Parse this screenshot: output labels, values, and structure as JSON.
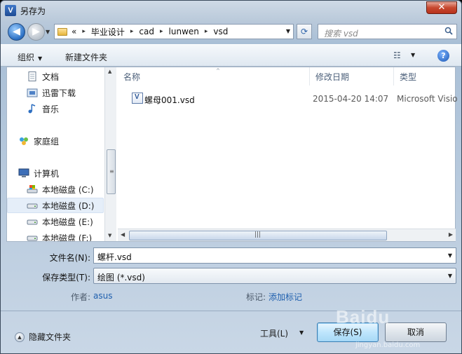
{
  "window": {
    "title": "另存为",
    "app_icon_letter": "V",
    "close_glyph": "✕"
  },
  "nav": {
    "back_glyph": "◀",
    "forward_glyph": "▶",
    "recent_glyph": "▼",
    "breadcrumb_prefix": "«",
    "breadcrumbs": [
      "毕业设计",
      "cad",
      "lunwen",
      "vsd"
    ],
    "breadcrumb_sep": "▸",
    "refresh_glyph": "⟳",
    "search_placeholder": "搜索 vsd"
  },
  "toolbar": {
    "organize_label": "组织",
    "organize_caret": "▼",
    "new_folder_label": "新建文件夹",
    "view_glyph": "☷",
    "view_caret": "▼",
    "help_glyph": "?"
  },
  "navpane": {
    "items": [
      {
        "label": "文档",
        "icon": "document-icon"
      },
      {
        "label": "迅雷下载",
        "icon": "download-folder-icon"
      },
      {
        "label": "音乐",
        "icon": "music-icon"
      },
      {
        "label": "家庭组",
        "icon": "homegroup-icon"
      },
      {
        "label": "计算机",
        "icon": "computer-icon"
      },
      {
        "label": "本地磁盘 (C:)",
        "icon": "system-drive-icon"
      },
      {
        "label": "本地磁盘 (D:)",
        "icon": "drive-icon",
        "selected": true
      },
      {
        "label": "本地磁盘 (E:)",
        "icon": "drive-icon"
      },
      {
        "label": "本地磁盘 (F:)",
        "icon": "drive-icon"
      }
    ]
  },
  "filelist": {
    "columns": [
      "名称",
      "修改日期",
      "类型"
    ],
    "sort_arrow": "^",
    "rows": [
      {
        "name": "螺母001.vsd",
        "modified": "2015-04-20 14:07",
        "type": "Microsoft Visio"
      }
    ]
  },
  "scrollbars": {
    "grip_v": "≡",
    "grip_h": "|||",
    "up": "▲",
    "down": "▼",
    "left": "◀",
    "right": "▶"
  },
  "form": {
    "filename_label": "文件名(N):",
    "filename_value": "螺杆.vsd",
    "filetype_label": "保存类型(T):",
    "filetype_value": "绘图 (*.vsd)",
    "author_label": "作者:",
    "author_value": "asus",
    "tags_label": "标记:",
    "tags_value": "添加标记",
    "caret": "▼"
  },
  "footer": {
    "hide_folders_label": "隐藏文件夹",
    "hide_folders_glyph": "▲",
    "tools_label": "工具(L)",
    "tools_caret": "▼",
    "save_label": "保存(S)",
    "cancel_label": "取消"
  },
  "watermark": {
    "brand": "Baidu",
    "sub": "jingyan.baidu.com"
  },
  "colors": {
    "accent": "#1f5fae",
    "close_red": "#c7482f",
    "selection": "#e5eef9"
  }
}
